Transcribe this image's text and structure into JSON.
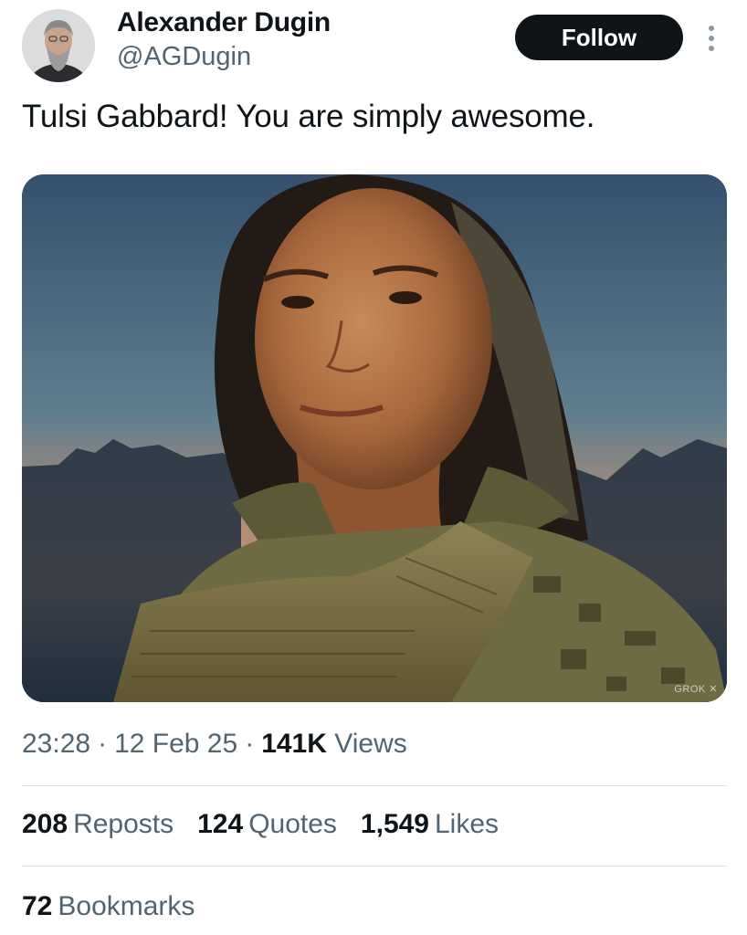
{
  "author": {
    "display_name": "Alexander Dugin",
    "handle": "@AGDugin",
    "avatar_icon": "profile-photo"
  },
  "actions": {
    "follow_label": "Follow",
    "more_icon": "more-vertical-icon"
  },
  "tweet": {
    "text": "Tulsi Gabbard! You are simply awesome."
  },
  "media": {
    "watermark": "GROK ✕"
  },
  "meta": {
    "time": "23:28",
    "separator": "·",
    "date": "12 Feb 25",
    "views_count": "141K",
    "views_label": "Views"
  },
  "stats": {
    "reposts_count": "208",
    "reposts_label": "Reposts",
    "quotes_count": "124",
    "quotes_label": "Quotes",
    "likes_count": "1,549",
    "likes_label": "Likes",
    "bookmarks_count": "72",
    "bookmarks_label": "Bookmarks"
  },
  "colors": {
    "text_primary": "#0f1419",
    "text_secondary": "#536471",
    "button_bg": "#0f1419",
    "divider": "#dfe3e6"
  }
}
